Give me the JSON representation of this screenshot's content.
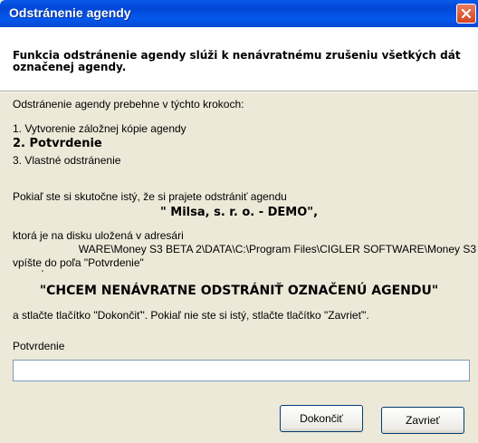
{
  "window": {
    "title": "Odstránenie agendy",
    "close_icon": "close-icon"
  },
  "header": {
    "text": "Funkcia odstránenie agendy slúži k nenávratnému zrušeniu všetkých dát označenej agendy."
  },
  "steps": {
    "intro": "Odstránenie agendy prebehne v týchto krokoch:",
    "step1": "1. Vytvorenie záložnej kópie agendy",
    "step2": "2. Potvrdenie",
    "step3": "3. Vlastné odstránenie"
  },
  "info": {
    "question": "Pokiaľ ste si skutočne istý, že si prajete odstrániť agendu",
    "agenda_name": "\" Milsa, s. r. o. - DEMO\",",
    "location": "ktorá je na disku uložená v adresári",
    "path": "WARE\\Money S3 BETA 2\\DATA\\C:\\Program Files\\CIGLER SOFTWARE\\Money S3",
    "write_into": "vpíšte do poľa \"Potvrdenie\"",
    "marker": "'",
    "phrase": "\"CHCEM NENÁVRATNE ODSTRÁNIŤ OZNAČENÚ AGENDU\"",
    "press": "a stlačte tlačítko \"Dokončiť\". Pokiaľ  nie ste si istý, stlačte tlačítko \"Zavrieť\"."
  },
  "confirmation": {
    "label": "Potvrdenie",
    "value": ""
  },
  "buttons": {
    "finish": "Dokončiť",
    "close": "Zavrieť"
  }
}
